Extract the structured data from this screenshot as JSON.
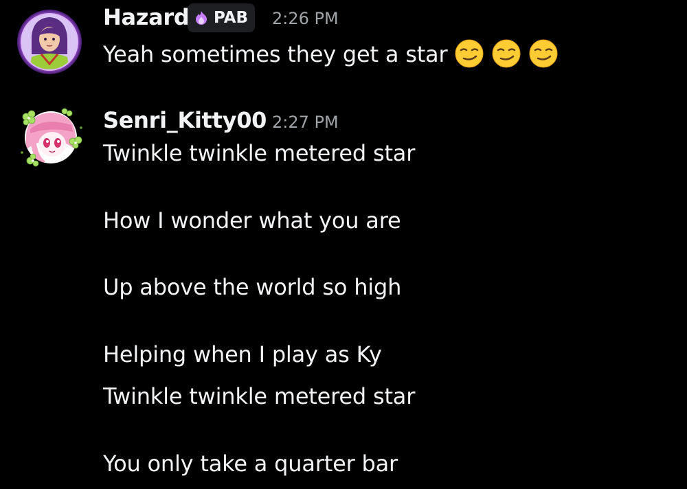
{
  "messages": [
    {
      "username": "Hazard",
      "badge": "PAB",
      "time": "2:26 PM",
      "lines": [
        "Yeah sometimes they get a star"
      ],
      "emojis": [
        "smirk-emoji",
        "smirk-emoji",
        "smirk-emoji"
      ],
      "avatar": "avatar-anime-woman-purple-hair"
    },
    {
      "username": "Senri_Kitty00",
      "time": "2:27 PM",
      "lines": [
        "Twinkle twinkle metered star",
        "How I wonder what you are",
        "Up above the world so high",
        "Helping when I play as Ky",
        "Twinkle twinkle metered star",
        "You only take a quarter bar"
      ],
      "avatar": "avatar-pink-hair-girl-clovers"
    }
  ],
  "colors": {
    "background": "#000000",
    "text": "#f2f3f5",
    "timestamp": "#a0a3a8",
    "badge_bg": "#1e1f22",
    "avatar_ring": "#c77dff"
  }
}
